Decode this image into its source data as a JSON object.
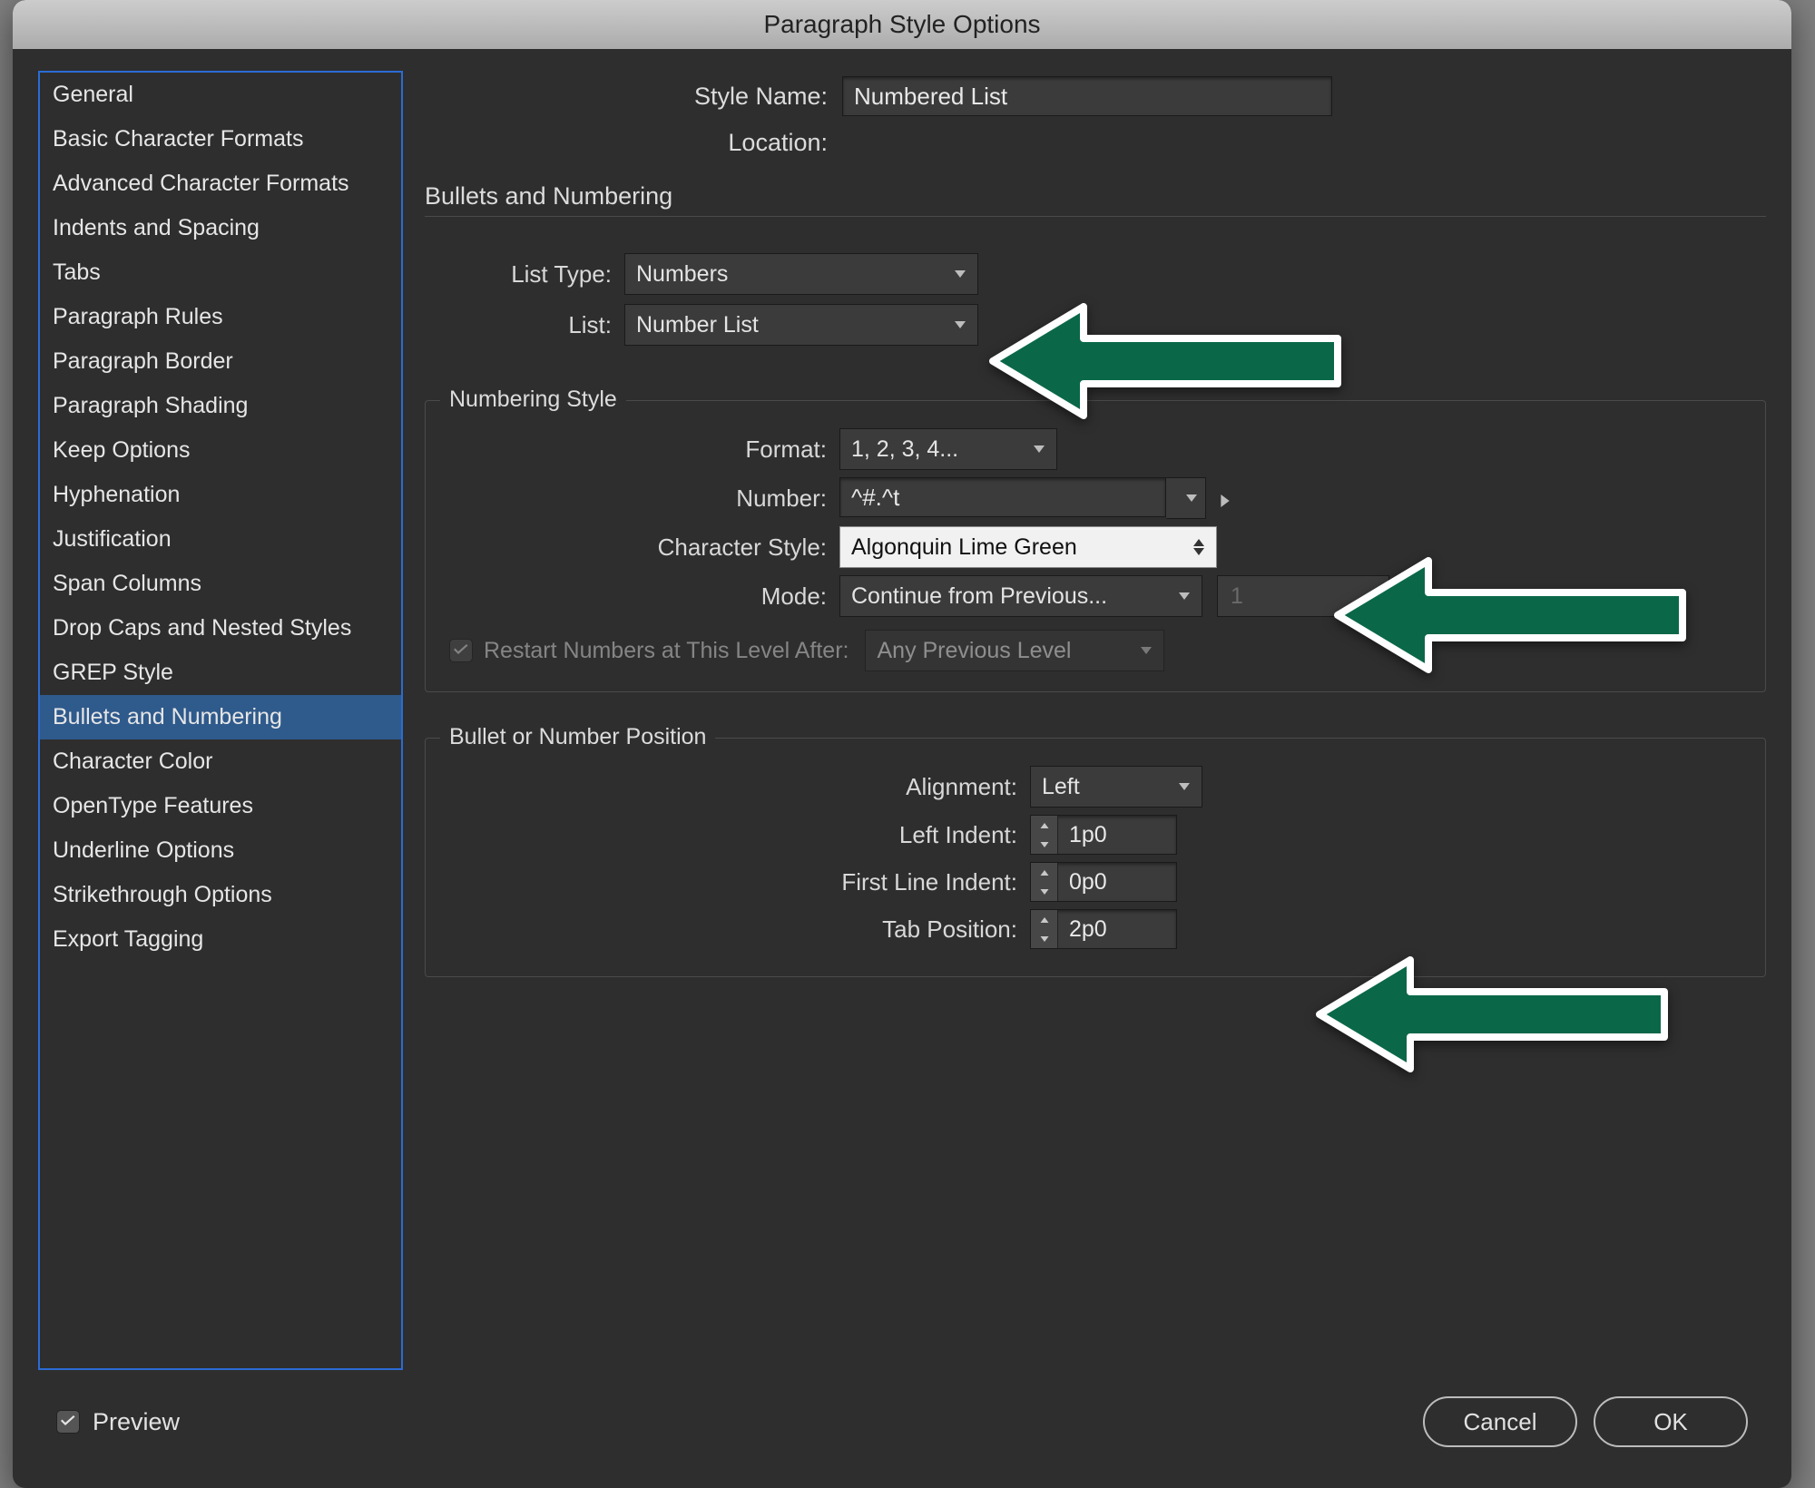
{
  "window": {
    "title": "Paragraph Style Options"
  },
  "header": {
    "style_name_label": "Style Name:",
    "style_name_value": "Numbered List",
    "location_label": "Location:"
  },
  "section_title": "Bullets and Numbering",
  "sidebar": {
    "items": [
      {
        "label": "General"
      },
      {
        "label": "Basic Character Formats"
      },
      {
        "label": "Advanced Character Formats"
      },
      {
        "label": "Indents and Spacing"
      },
      {
        "label": "Tabs"
      },
      {
        "label": "Paragraph Rules"
      },
      {
        "label": "Paragraph Border"
      },
      {
        "label": "Paragraph Shading"
      },
      {
        "label": "Keep Options"
      },
      {
        "label": "Hyphenation"
      },
      {
        "label": "Justification"
      },
      {
        "label": "Span Columns"
      },
      {
        "label": "Drop Caps and Nested Styles"
      },
      {
        "label": "GREP Style"
      },
      {
        "label": "Bullets and Numbering"
      },
      {
        "label": "Character Color"
      },
      {
        "label": "OpenType Features"
      },
      {
        "label": "Underline Options"
      },
      {
        "label": "Strikethrough Options"
      },
      {
        "label": "Export Tagging"
      }
    ],
    "selected_index": 14
  },
  "list_settings": {
    "list_type_label": "List Type:",
    "list_type_value": "Numbers",
    "list_label": "List:",
    "list_value": "Number List"
  },
  "numbering_style": {
    "legend": "Numbering Style",
    "format_label": "Format:",
    "format_value": "1, 2, 3, 4...",
    "number_label": "Number:",
    "number_value": "^#.^t",
    "char_style_label": "Character Style:",
    "char_style_value": "Algonquin Lime Green",
    "mode_label": "Mode:",
    "mode_value": "Continue from Previous...",
    "mode_number": "1",
    "restart_label": "Restart Numbers at This Level After:",
    "restart_value": "Any Previous Level",
    "restart_checked": true,
    "restart_enabled": false
  },
  "position": {
    "legend": "Bullet or Number Position",
    "alignment_label": "Alignment:",
    "alignment_value": "Left",
    "left_indent_label": "Left Indent:",
    "left_indent_value": "1p0",
    "first_line_label": "First Line Indent:",
    "first_line_value": "0p0",
    "tab_position_label": "Tab Position:",
    "tab_position_value": "2p0"
  },
  "footer": {
    "preview_label": "Preview",
    "preview_checked": true,
    "cancel": "Cancel",
    "ok": "OK"
  },
  "colors": {
    "arrow_fill": "#0a6848",
    "arrow_stroke": "#ffffff"
  }
}
